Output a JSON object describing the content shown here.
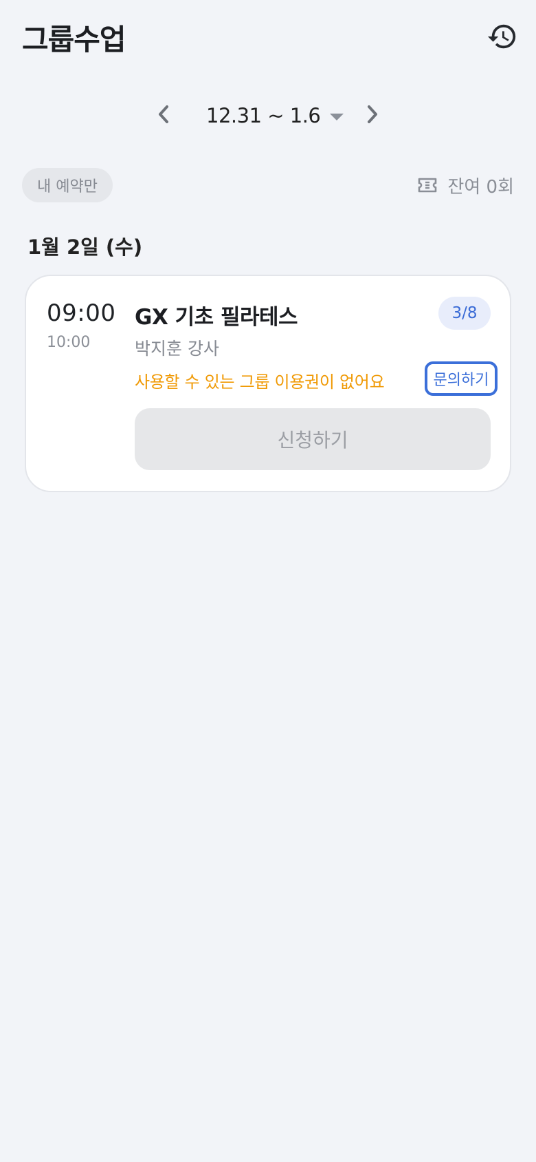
{
  "header": {
    "title": "그룹수업",
    "history_icon": "history-icon"
  },
  "week_nav": {
    "range": "12.31 ~ 1.6",
    "prev_icon": "chevron-left-icon",
    "next_icon": "chevron-right-icon",
    "dropdown_icon": "caret-down-icon"
  },
  "filter": {
    "my_reservations_label": "내 예약만"
  },
  "tickets": {
    "remaining_label": "잔여 0회",
    "icon": "ticket-icon"
  },
  "schedule": {
    "day_heading": "1월 2일 (수)",
    "classes": [
      {
        "start_time": "09:00",
        "end_time": "10:00",
        "title": "GX 기초 필라테스",
        "instructor": "박지훈 강사",
        "capacity": "3/8",
        "warning": "사용할 수 있는 그룹 이용권이 없어요",
        "inquiry_label": "문의하기",
        "apply_label": "신청하기"
      }
    ]
  },
  "colors": {
    "background": "#f2f4f8",
    "accent": "#3b6fd9",
    "warning": "#f09a06",
    "disabled": "#e6e7e9"
  }
}
